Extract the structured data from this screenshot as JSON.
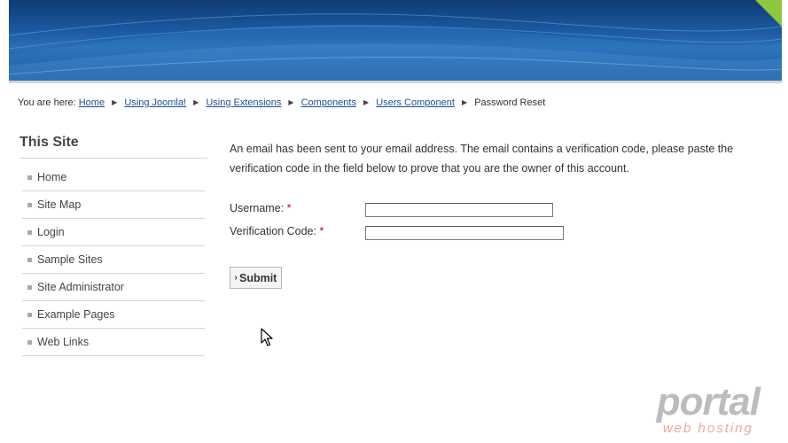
{
  "breadcrumb": {
    "prefix": "You are here:",
    "links": [
      "Home",
      "Using Joomla!",
      "Using Extensions",
      "Components",
      "Users Component"
    ],
    "current": "Password Reset"
  },
  "sidebar": {
    "title": "This Site",
    "items": [
      {
        "label": "Home"
      },
      {
        "label": "Site Map"
      },
      {
        "label": "Login"
      },
      {
        "label": "Sample Sites"
      },
      {
        "label": "Site Administrator"
      },
      {
        "label": "Example Pages"
      },
      {
        "label": "Web Links"
      }
    ]
  },
  "main": {
    "intro": "An email has been sent to your email address. The email contains a verification code, please paste the verification code in the field below to prove that you are the owner of this account.",
    "form": {
      "username_label": "Username:",
      "username_value": "",
      "code_label": "Verification Code:",
      "code_value": "",
      "required_mark": "*",
      "submit_label": "Submit"
    }
  },
  "watermark": {
    "logo": "portal",
    "tagline": "web hosting"
  },
  "colors": {
    "banner_dark": "#103a73",
    "banner_light": "#2a6fb6",
    "accent_green": "#8dc63f",
    "link": "#1f4f91",
    "required": "#cc0000"
  }
}
